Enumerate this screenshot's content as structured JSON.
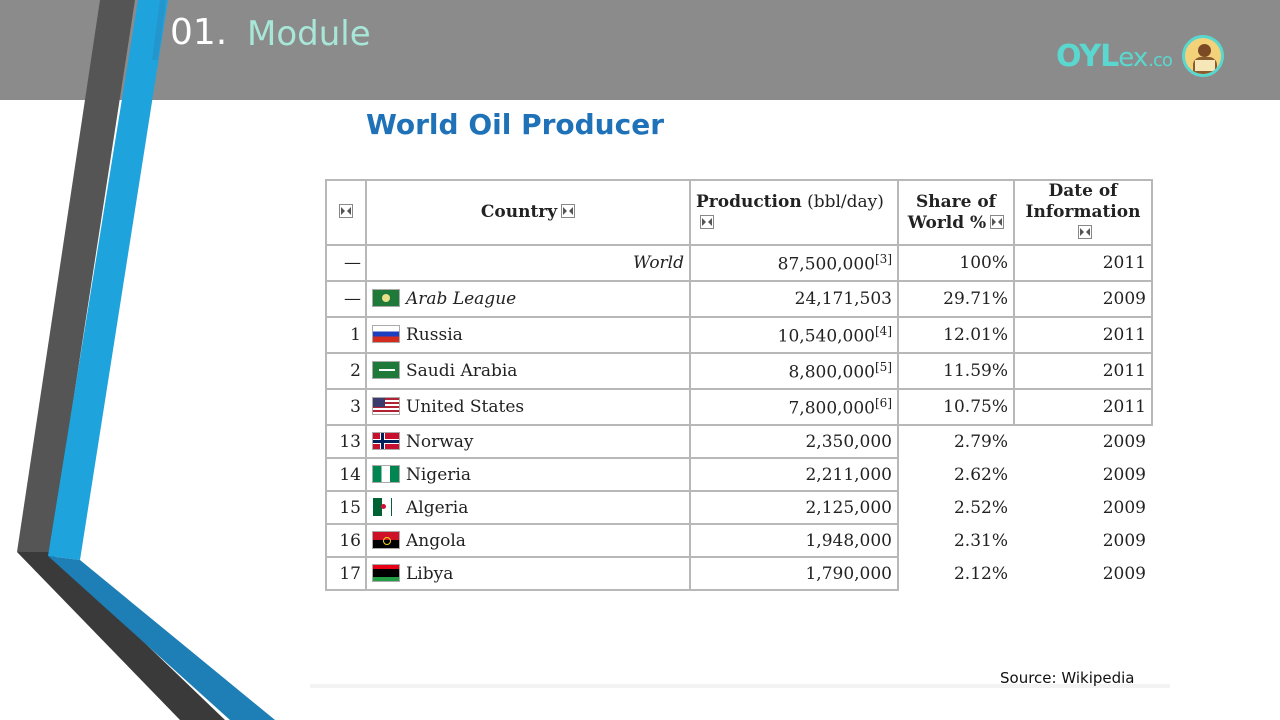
{
  "slide": {
    "module_number": "01.",
    "module_name": "Module",
    "title": "World  Oil Producer",
    "source": "Source: Wikipedia",
    "logo": {
      "main": "OYL",
      "ex": "ex",
      "tld": ".co"
    }
  },
  "table": {
    "headers": {
      "rank_icon": "sort-icon",
      "country": "Country",
      "production_bold": "Production",
      "production_unit": " (bbl/day)",
      "share_line1": "Share of",
      "share_line2": "World %",
      "date_line1": "Date of",
      "date_line2": "Information"
    },
    "rows": [
      {
        "rank": "—",
        "country": "World",
        "production": "87,500,000",
        "ref": "[3]",
        "share": "100%",
        "date": "2011"
      },
      {
        "rank": "—",
        "country": "Arab League",
        "production": "24,171,503",
        "ref": "",
        "share": "29.71%",
        "date": "2009"
      },
      {
        "rank": "1",
        "country": "Russia",
        "production": "10,540,000",
        "ref": "[4]",
        "share": "12.01%",
        "date": "2011"
      },
      {
        "rank": "2",
        "country": "Saudi Arabia",
        "production": "8,800,000",
        "ref": "[5]",
        "share": "11.59%",
        "date": "2011"
      },
      {
        "rank": "3",
        "country": "United States",
        "production": "7,800,000",
        "ref": "[6]",
        "share": "10.75%",
        "date": "2011"
      },
      {
        "rank": "13",
        "country": "Norway",
        "production": "2,350,000",
        "ref": "",
        "share": "2.79%",
        "date": "2009"
      },
      {
        "rank": "14",
        "country": "Nigeria",
        "production": "2,211,000",
        "ref": "",
        "share": "2.62%",
        "date": "2009"
      },
      {
        "rank": "15",
        "country": "Algeria",
        "production": "2,125,000",
        "ref": "",
        "share": "2.52%",
        "date": "2009"
      },
      {
        "rank": "16",
        "country": "Angola",
        "production": "1,948,000",
        "ref": "",
        "share": "2.31%",
        "date": "2009"
      },
      {
        "rank": "17",
        "country": "Libya",
        "production": "1,790,000",
        "ref": "",
        "share": "2.12%",
        "date": "2009"
      }
    ]
  },
  "colors": {
    "topbar": "#8b8b8b",
    "title": "#1f72b8",
    "accent_blue": "#1fa3dd",
    "accent_dark": "#3b3b3b",
    "module_name": "#a8e6d8",
    "logo": "#5ad8d0"
  }
}
